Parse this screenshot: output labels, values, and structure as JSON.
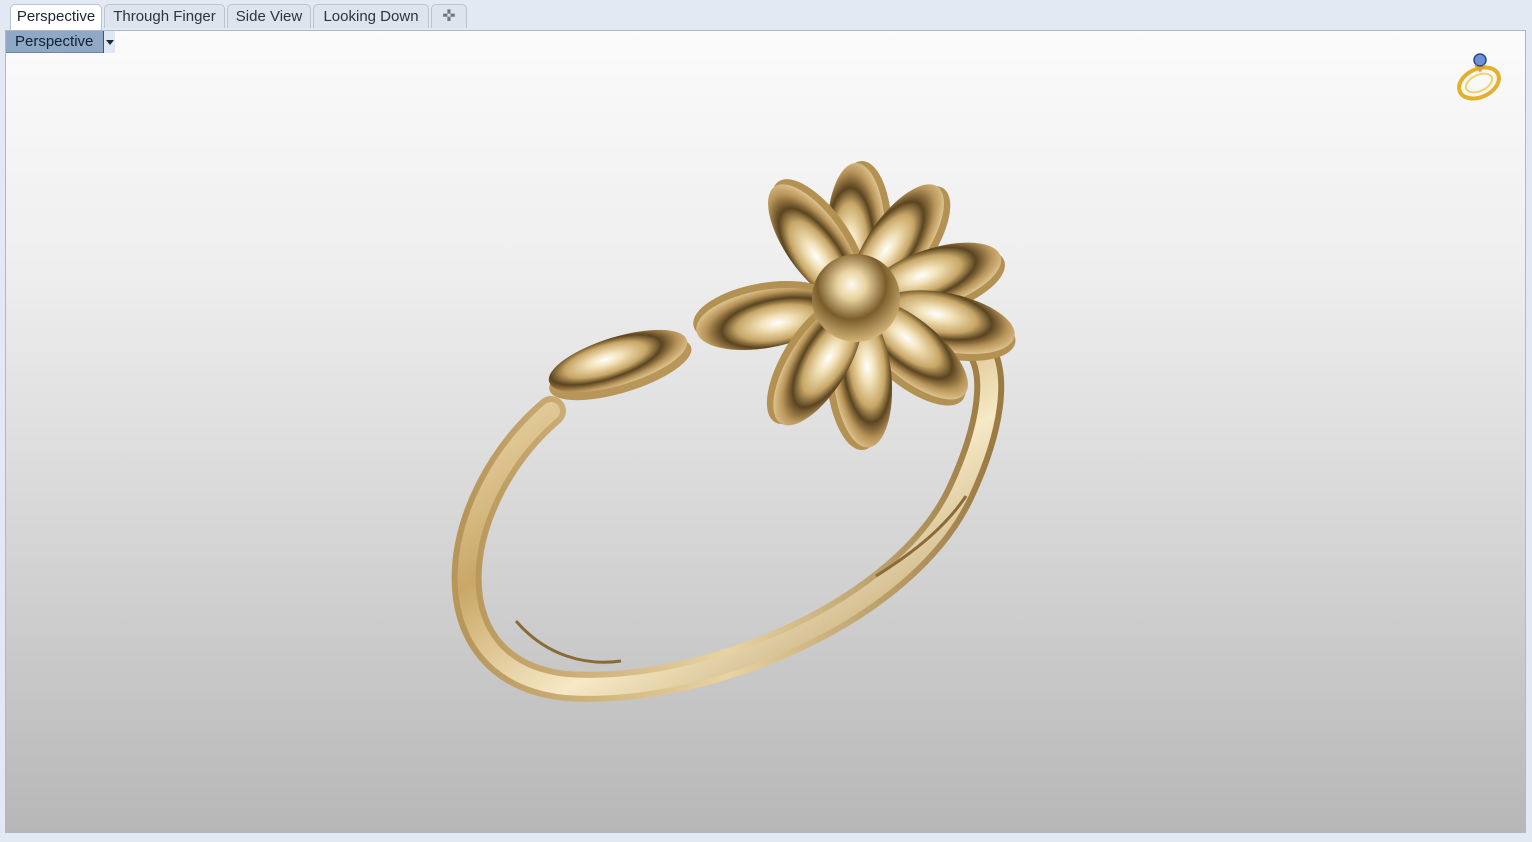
{
  "tabs": [
    {
      "label": "Perspective",
      "active": true
    },
    {
      "label": "Through Finger",
      "active": false
    },
    {
      "label": "Side View",
      "active": false
    },
    {
      "label": "Looking Down",
      "active": false
    }
  ],
  "tab_add_icon": "plus-icon",
  "viewport": {
    "label": "Perspective",
    "dropdown_icon": "caret-down-icon",
    "corner_icon": "ring-icon"
  },
  "colors": {
    "gold": "#d6b77e",
    "active_label_bg": "#8fa8c5"
  }
}
